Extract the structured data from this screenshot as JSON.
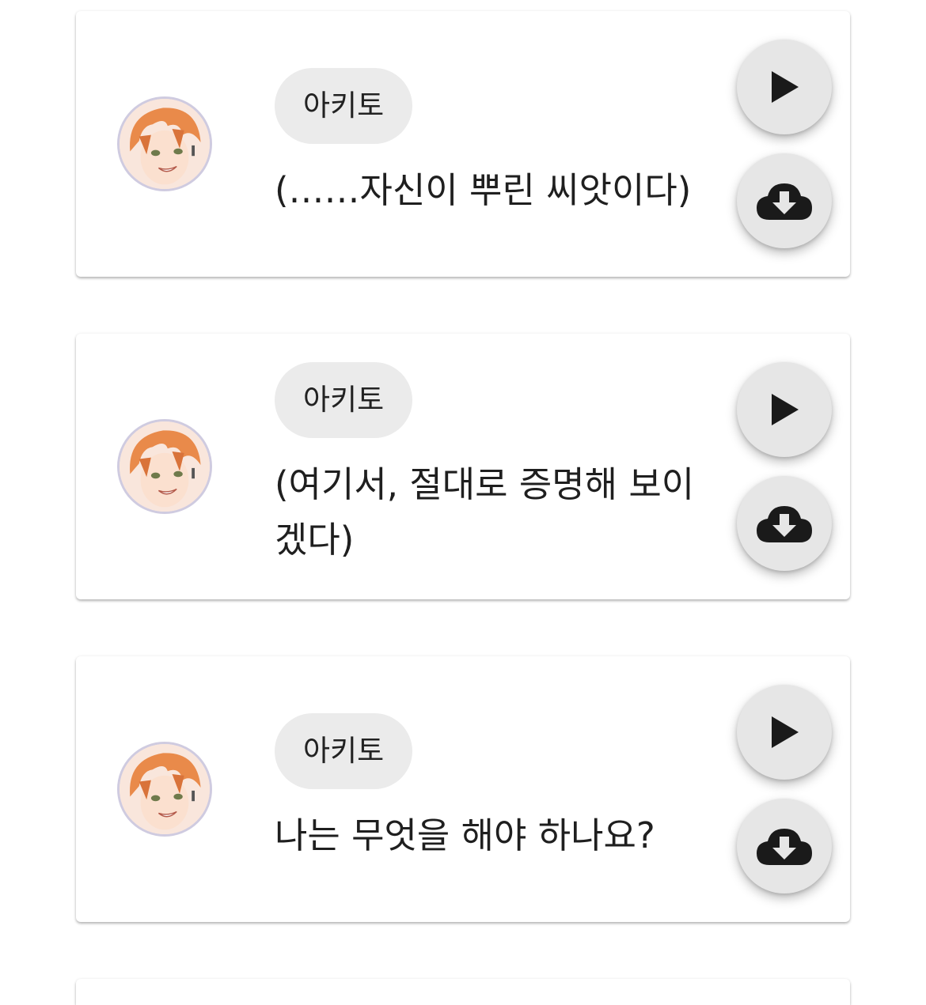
{
  "messages": [
    {
      "speaker": "아키토",
      "text": "(……자신이 뿌린 씨앗이다)",
      "play_icon": "play-icon",
      "download_icon": "cloud-download-icon"
    },
    {
      "speaker": "아키토",
      "text": "(여기서, 절대로 증명해 보이겠다)",
      "play_icon": "play-icon",
      "download_icon": "cloud-download-icon"
    },
    {
      "speaker": "아키토",
      "text": "나는 무엇을 해야 하나요?",
      "play_icon": "play-icon",
      "download_icon": "cloud-download-icon"
    }
  ],
  "colors": {
    "card_background": "#ffffff",
    "chip_background": "#ebebeb",
    "fab_background": "#e6e6e6",
    "icon": "#1a1a1a",
    "avatar_hair": "#e98a4a"
  }
}
